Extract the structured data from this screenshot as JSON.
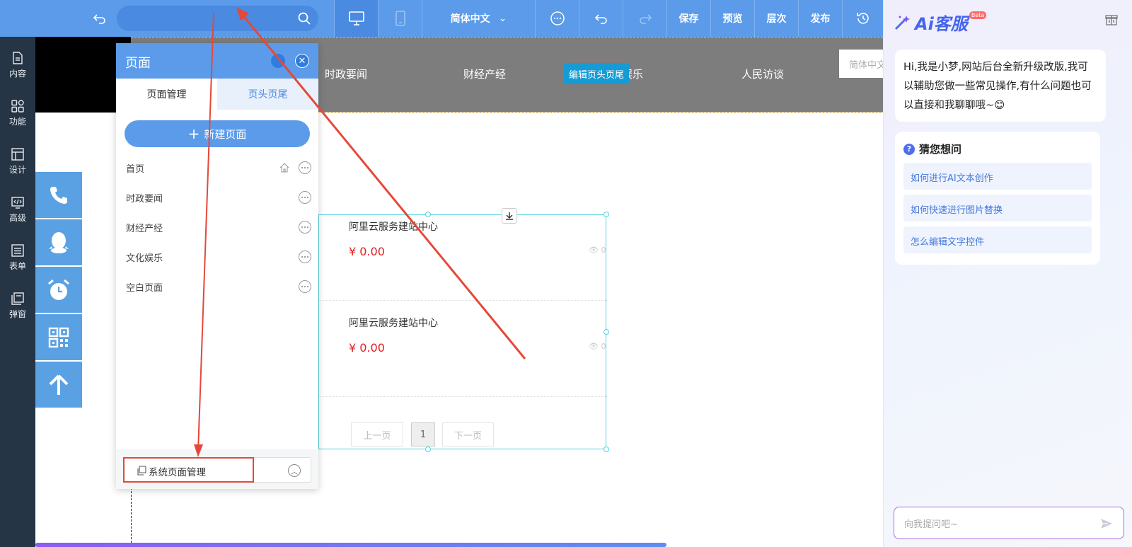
{
  "toolbar": {
    "language": "简体中文",
    "save": "保存",
    "preview": "预览",
    "layers": "层次",
    "publish": "发布"
  },
  "sidebar": {
    "items": [
      {
        "label": "内容",
        "icon": "document-icon"
      },
      {
        "label": "功能",
        "icon": "grid-icon"
      },
      {
        "label": "设计",
        "icon": "layout-icon"
      },
      {
        "label": "高级",
        "icon": "code-icon"
      },
      {
        "label": "表单",
        "icon": "list-icon"
      },
      {
        "label": "弹窗",
        "icon": "popup-icon"
      }
    ]
  },
  "site_header": {
    "nav": [
      "时政要闻",
      "财经产经",
      "娱乐",
      "人民访谈"
    ],
    "edit_button": "编辑页头页尾",
    "language": "简体中文"
  },
  "products": [
    {
      "title": "阿里云服务建站中心",
      "price": "¥ 0.00",
      "views": "0"
    },
    {
      "title": "阿里云服务建站中心",
      "price": "¥ 0.00",
      "views": "0"
    }
  ],
  "pagination": {
    "prev": "上一页",
    "current": "1",
    "next": "下一页"
  },
  "page_panel": {
    "title": "页面",
    "tabs": [
      "页面管理",
      "页头页尾"
    ],
    "new_page": "新建页面",
    "pages": [
      "首页",
      "时政要闻",
      "财经产经",
      "文化娱乐",
      "空白页面"
    ],
    "system_pages": "系统页面管理"
  },
  "ai_panel": {
    "title": "Ai客服",
    "badge": "Beta",
    "greeting": "Hi,我是小梦,网站后台全新升级改版,我可以辅助您做一些常见操作,有什么问题也可以直接和我聊聊哦~😊",
    "suggest_title": "猜您想问",
    "suggestions": [
      "如何进行AI文本创作",
      "如何快速进行图片替换",
      "怎么编辑文字控件"
    ],
    "input_placeholder": "向我提问吧~"
  },
  "colors": {
    "toolbar_blue": "#5b9bea",
    "sidebar_dark": "#263545",
    "price_red": "#e02020",
    "annotation_red": "#e5483a"
  }
}
